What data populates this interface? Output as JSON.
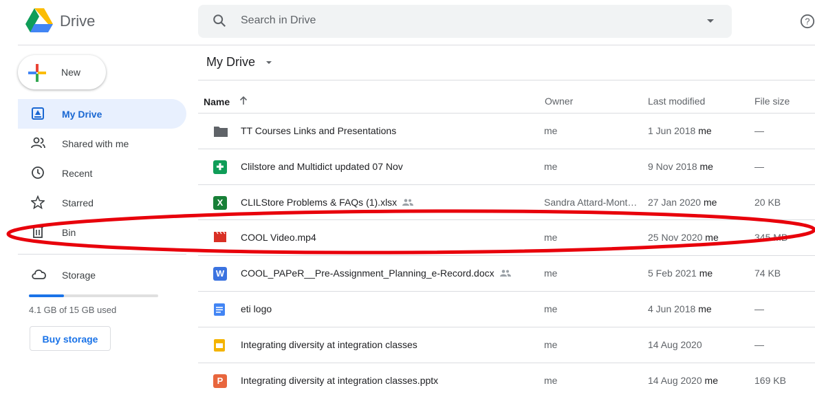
{
  "app": {
    "name": "Drive"
  },
  "search": {
    "placeholder": "Search in Drive"
  },
  "sidebar": {
    "new_label": "New",
    "items": [
      {
        "label": "My Drive",
        "icon": "my-drive-icon",
        "active": true
      },
      {
        "label": "Shared with me",
        "icon": "shared-icon",
        "active": false
      },
      {
        "label": "Recent",
        "icon": "clock-icon",
        "active": false
      },
      {
        "label": "Starred",
        "icon": "star-icon",
        "active": false
      },
      {
        "label": "Bin",
        "icon": "bin-icon",
        "active": false
      }
    ],
    "storage": {
      "label": "Storage",
      "used_text": "4.1 GB of 15 GB used",
      "used_fraction": 0.27,
      "buy_label": "Buy storage"
    }
  },
  "main": {
    "breadcrumb": "My Drive",
    "columns": {
      "name": "Name",
      "owner": "Owner",
      "modified": "Last modified",
      "size": "File size"
    },
    "files": [
      {
        "name": "TT Courses Links and Presentations",
        "type": "folder",
        "owner": "me",
        "modified_date": "1 Jun 2018",
        "modified_by": "me",
        "size": "—",
        "shared": false
      },
      {
        "name": "Clilstore and Multidict updated 07 Nov",
        "type": "form",
        "owner": "me",
        "modified_date": "9 Nov 2018",
        "modified_by": "me",
        "size": "—",
        "shared": false
      },
      {
        "name": "CLILStore Problems & FAQs (1).xlsx",
        "type": "excel",
        "owner": "Sandra Attard-Mont…",
        "modified_date": "27 Jan 2020",
        "modified_by": "me",
        "size": "20 KB",
        "shared": true
      },
      {
        "name": "COOL Video.mp4",
        "type": "video",
        "owner": "me",
        "modified_date": "25 Nov 2020",
        "modified_by": "me",
        "size": "345 MB",
        "shared": false
      },
      {
        "name": "COOL_PAPeR__Pre-Assignment_Planning_e-Record.docx",
        "type": "word",
        "owner": "me",
        "modified_date": "5 Feb 2021",
        "modified_by": "me",
        "size": "74 KB",
        "shared": true
      },
      {
        "name": "eti logo",
        "type": "doc",
        "owner": "me",
        "modified_date": "4 Jun 2018",
        "modified_by": "me",
        "size": "—",
        "shared": false
      },
      {
        "name": "Integrating diversity at integration classes",
        "type": "slides",
        "owner": "me",
        "modified_date": "14 Aug 2020",
        "modified_by": "",
        "size": "—",
        "shared": false
      },
      {
        "name": "Integrating diversity at integration classes.pptx",
        "type": "pptx",
        "owner": "me",
        "modified_date": "14 Aug 2020",
        "modified_by": "me",
        "size": "169 KB",
        "shared": false
      }
    ]
  },
  "colors": {
    "accent": "#1a73e8",
    "active_bg": "#e8f0fe",
    "highlight_ellipse": "#e8000b"
  }
}
